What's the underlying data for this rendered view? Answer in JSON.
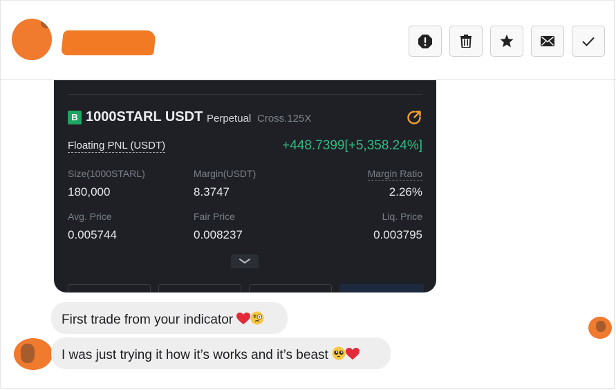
{
  "header": {
    "actions": [
      {
        "name": "report-button",
        "icon": "exclamation-octagon-icon"
      },
      {
        "name": "delete-button",
        "icon": "trash-icon"
      },
      {
        "name": "star-button",
        "icon": "star-icon"
      },
      {
        "name": "mark-unread-button",
        "icon": "envelope-icon"
      },
      {
        "name": "done-button",
        "icon": "checkmark-icon"
      }
    ]
  },
  "screenshot_card": {
    "badge": "B",
    "symbol": "1000STARL USDT",
    "contract_type": "Perpetual",
    "margin_mode": "Cross.125X",
    "pnl_label": "Floating PNL (USDT)",
    "pnl_value": "+448.7399[+5,358.24%]",
    "size_label": "Size(1000STARL)",
    "size_value": "180,000",
    "margin_label": "Margin(USDT)",
    "margin_value": "8.3747",
    "margin_ratio_label": "Margin Ratio",
    "margin_ratio_value": "2.26%",
    "avg_price_label": "Avg. Price",
    "avg_price_value": "0.005744",
    "fair_price_label": "Fair Price",
    "fair_price_value": "0.008237",
    "liq_price_label": "Liq. Price",
    "liq_price_value": "0.003795",
    "colors": {
      "positive": "#2ebd85",
      "badge": "#1fa462",
      "accent": "#f0a030",
      "card_bg": "#1e2025"
    }
  },
  "messages": [
    {
      "text": "First trade from your indicator",
      "emojis": [
        "heart-emoji",
        "monocle-face-emoji"
      ]
    },
    {
      "text": "I was just trying it how it’s works and  it’s beast",
      "emojis": [
        "pleading-face-emoji",
        "heart-emoji"
      ]
    }
  ]
}
